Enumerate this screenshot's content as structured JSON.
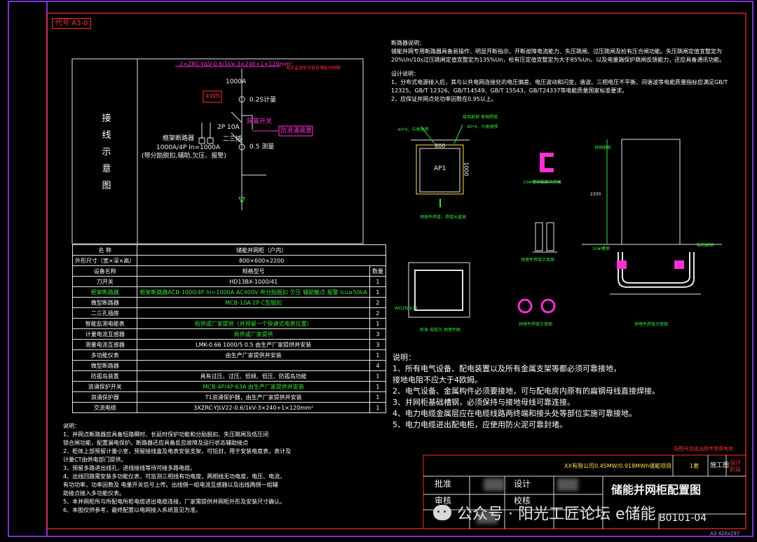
{
  "drawing_code": "代号·A3-0",
  "sheet_size": "A3 420x297",
  "wiring": {
    "vertical_label": [
      "接",
      "线",
      "示",
      "意",
      "图"
    ],
    "cable_spec": "2×ZRC-YJLV-0.6/1kV-3×240+1×120mm²",
    "note_red": "电压监测信号取自储能并网侧",
    "current_1000a": "1000A",
    "meter_label": "0.2S计量",
    "kwh_symbol": "kWh",
    "isolation_switch": "隔离开关",
    "spd": "防浪涌装置",
    "breaker_2p": "2P 10A",
    "socket_label": "二三插",
    "frame_breaker": "框架断路器",
    "frame_spec": "1000A/4P In=1000A",
    "frame_features": "(带分励脱扣,辅助,欠压、报警)",
    "measure_label": "0.5 测量"
  },
  "spec_table": {
    "header": {
      "name": "名  称",
      "value": "储能并网柜（户内）"
    },
    "dims": {
      "name": "外形尺寸（宽×深×高）",
      "value": "800×600×2200"
    },
    "cols": {
      "name": "设备名称",
      "spec": "规格型号",
      "qty": "数量"
    },
    "rows": [
      {
        "name": "刀开关",
        "spec": "HD13BX-1000/41",
        "qty": "1",
        "color": "w"
      },
      {
        "name": "框架断路器",
        "spec": "框架断路器ACB-1000/4P In=1000A AC400V 带分励脱扣 欠压 辅助触点 报警 Icu≥50kA",
        "qty": "1",
        "color": "g"
      },
      {
        "name": "微型断路器",
        "spec": "MCB-10A 2P C型脱扣",
        "qty": "2",
        "color": "g"
      },
      {
        "name": "二三孔插座",
        "spec": "",
        "qty": "2",
        "color": "w"
      },
      {
        "name": "智能监测电能表",
        "spec": "局供或厂家提供（并预留一个快速式电表位置）",
        "qty": "1",
        "color": "g"
      },
      {
        "name": "计量电流互感器",
        "spec": "局供或厂家提供",
        "qty": "3",
        "color": "g"
      },
      {
        "name": "测量电流互感器",
        "spec": "LMK-0.66 1000/5 0.5    由生产厂家提供并安装",
        "qty": "3",
        "color": "w"
      },
      {
        "name": "多功能仪表",
        "spec": "由生产厂家提供并安装",
        "qty": "1",
        "color": "w"
      },
      {
        "name": "微型断路器",
        "spec": "",
        "qty": "4",
        "color": "w"
      },
      {
        "name": "防孤岛装置",
        "spec": "具有过压、过压、低频、低压、防孤岛功能",
        "qty": "1",
        "color": "w"
      },
      {
        "name": "浪涌保护开关",
        "spec": "MCB-4P/4P-63A    由生产厂家提供并安装",
        "qty": "1",
        "color": "g"
      },
      {
        "name": "浪涌保护器",
        "spec": "T1浪涌保护器，由生产厂家提供并安装",
        "qty": "1",
        "color": "w"
      },
      {
        "name": "交流电缆",
        "spec": "3XZRC-YJLV22-0.6/1kV-3×240+1×120mm²",
        "qty": "1",
        "color": "w"
      }
    ]
  },
  "left_notes": {
    "title": "说明：",
    "lines": [
      "1、并网点断路器应具备短路瞬时、长延时保护功能和分励脱扣、失压跳闸及低压闭",
      "   锁合闸功能，配置漏电保护。断路器还应具备反应故障及运行状态辅助接点",
      "2、柜体上部预留计量小室，预留接线盒及电表安装支架，可铅封，用于安装电度表，表计及",
      "   计量CT由供电部门提供。",
      "3、预留多路进出线孔，进线接线等待可接多路电缆。",
      "4、出线回路需安装多功能仪表，可监测三相线有功电度，两相线无功电度，电压、电流，",
      "   有功功率，功率因数及 电量开关信号上传。出线侧一组电流互感器以及出线两侧一组辅",
      "   助接点接入多功能仪表。",
      "5、本并网柜所与所配电所柜电缆进出电缆连接，厂家需提供并网柜外形及安装尺寸确认。",
      "6、本图仅供参考，最终配置以电网接入系统意见为准。"
    ]
  },
  "top_notes": {
    "title1": "断路器说明：",
    "para1": [
      "储能并网专用断路器具备易操作、明显开断指示、开断故障电流能力、失压跳闸、过压跳闸及检有压合闸功能。失压跳闸定值宜整定为",
      "20%Un/10s过压跳闸定值宜整定为135%Un，检有压定值宜整定为大于85%Un。以及电量端保护跳闸反馈能力，还应具备通讯功能。"
    ],
    "title2": "设计说明：",
    "para2": [
      "1、分布式电源接入后，其与公共电网连接处的电压偏差、电压波动和闪变、谐波、三相电压不平衡、间谐波等电能质量指标应满足GB/T",
      "12325、GB/T 12326、GB/T14549、GB/T 15543、GB/T24337等电能质量国家标准要求。",
      "2、应保证并网点处功率因数在0.95以上。"
    ]
  },
  "drawings": {
    "ap1": "AP1",
    "w800": "800",
    "h1000": "1000",
    "fixing_note": "预埋件焊接，焊接长度高",
    "angle_note1": "40*4，与角钢焊",
    "angle_note2": "40*4，与角钢焊",
    "base_note": "接地扁钢 角钢焊接",
    "channel_label": "10#槽钢截面示意图",
    "channel_section": "预埋件焊接示意图",
    "pipe_label": "预埋件焊接示意图",
    "frame_label": "WDZN-b14",
    "frame_caption": "柜体 电缆沟 预埋件图",
    "cabinet_label": "并网柜柜",
    "cable_cap": "预埋件焊接示意图",
    "side_note": "接地扁钢",
    "rod_note": "10#槽钢",
    "cabinet_dim": "2200"
  },
  "bottom_notes": {
    "title": "说明：",
    "lines": [
      "1、所有电气设备、配电装置以及所有金属支架等都必须可靠接地，",
      "   接地电阻不应大于4欧姆。",
      "2、电气设备、金属构件必须要接地，可与配电房内原有的扁钢母线直接焊接。",
      "3、并网柜基础槽钢，必须保持与接地母线可靠连接。",
      "4、电力电缆金属层应在电缆线路两终端和接头处等部位实施可靠接地。",
      "5、电力电缆进出配电柜，应使用防火泥可靠封堵。"
    ]
  },
  "title_block": {
    "red_note": "配图号加盖出图专用章有效",
    "project": "XX有限公司0.45MW/0.918MWh储能项目",
    "stage_label": "施工图",
    "version": "1套",
    "design_stage": "设计阶段",
    "approve": "批准",
    "check": "审核",
    "design": "设计",
    "proof": "校核",
    "drawing_title": "储能并网柜配置图",
    "drawing_no": "B0101-04",
    "watermark": "公众号 · 阳光工匠论坛 e储能"
  }
}
